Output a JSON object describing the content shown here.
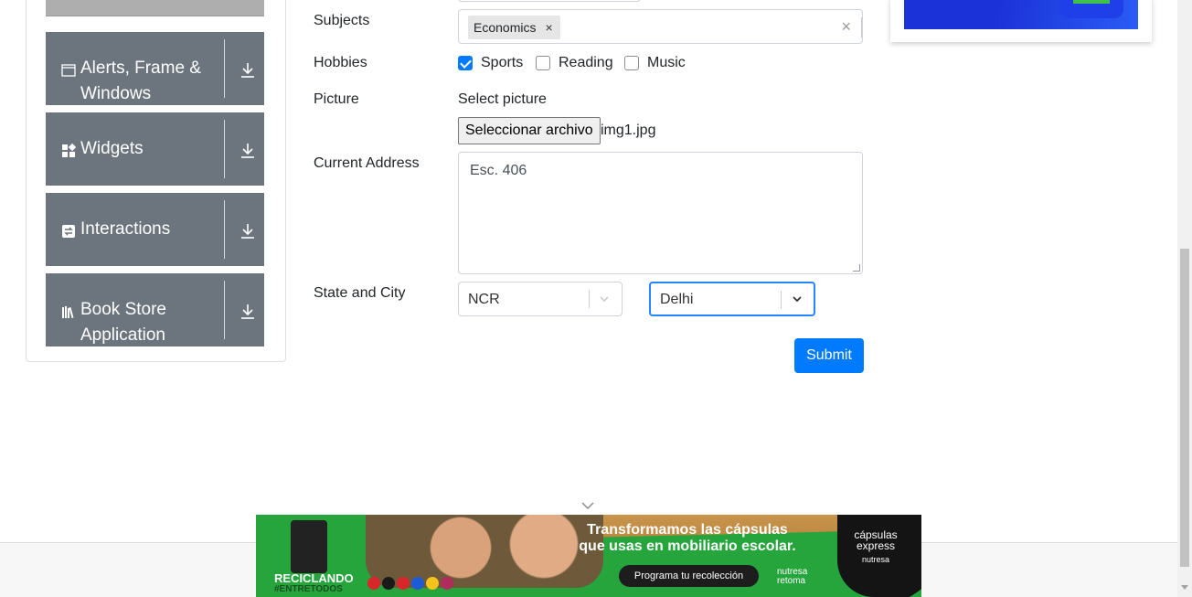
{
  "sidebar": {
    "groups": [
      {
        "label": "Alerts, Frame & Windows",
        "icon": "window-icon"
      },
      {
        "label": "Widgets",
        "icon": "widgets-icon"
      },
      {
        "label": "Interactions",
        "icon": "interactions-icon"
      },
      {
        "label": "Book Store Application",
        "icon": "books-icon"
      }
    ]
  },
  "form": {
    "subjects_label": "Subjects",
    "subject_chip": "Economics",
    "chip_remove": "×",
    "clear_all": "×",
    "hobbies_label": "Hobbies",
    "hobbies": [
      {
        "label": "Sports",
        "checked": true
      },
      {
        "label": "Reading",
        "checked": false
      },
      {
        "label": "Music",
        "checked": false
      }
    ],
    "picture_label": "Picture",
    "select_picture": "Select picture",
    "file_button": "Seleccionar archivo",
    "file_name": "img1.jpg",
    "address_label": "Current Address",
    "address_value": "Esc. 406",
    "state_city_label": "State and City",
    "state_value": "NCR",
    "city_value": "Delhi",
    "submit_label": "Submit"
  },
  "banner": {
    "headline_1": "Transformamos las cápsulas",
    "headline_2": "que usas en mobiliario escolar.",
    "cta": "Programa tu recolección",
    "left_brand": "RECICLANDO",
    "left_tag": "#ENTRETODOS",
    "nutresa_1": "nutresa",
    "nutresa_2": "retoma",
    "capsulas_1": "cápsulas",
    "capsulas_2": "express",
    "capsulas_3": "nutresa"
  },
  "colors": {
    "primary": "#007bff",
    "sidebar_group": "#6c757d",
    "focus_border": "#2684ff"
  }
}
